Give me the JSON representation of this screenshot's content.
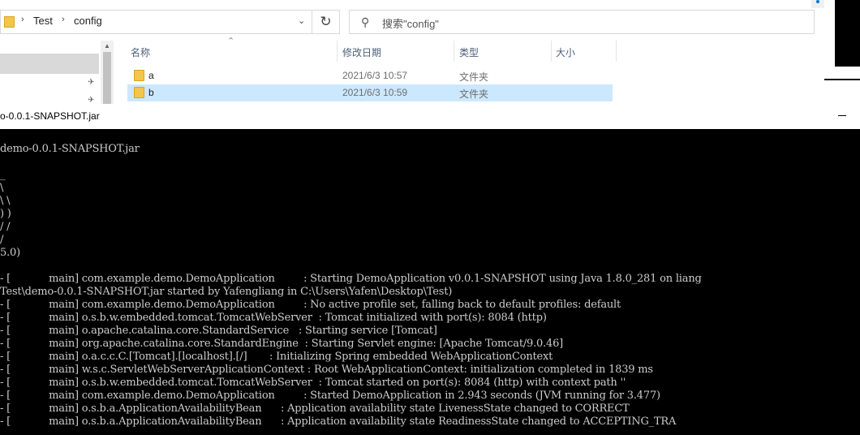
{
  "explorer": {
    "breadcrumb": [
      "Test",
      "config"
    ],
    "separator": "›",
    "dropdown_glyph": "⌄",
    "refresh_glyph": "↻",
    "search_placeholder": "搜索\"config\"",
    "search_icon": "search-icon",
    "columns": [
      "名称",
      "修改日期",
      "类型",
      "大小"
    ],
    "sort_glyph": "⌃",
    "files": [
      {
        "name": "a",
        "modified": "2021/6/3 10:57",
        "type": "文件夹",
        "selected": false
      },
      {
        "name": "b",
        "modified": "2021/6/3 10:59",
        "type": "文件夹",
        "selected": true
      }
    ],
    "pin_glyph": "📌"
  },
  "console": {
    "title": "o-0.0.1-SNAPSHOT.jar",
    "lines": [
      "demo-0.0.1-SNAPSHOT.jar",
      "",
      "_",
      "\\",
      "\\ \\",
      ") )",
      "/ /",
      "/",
      "5.0)",
      "",
      "- [            main] com.example.demo.DemoApplication         : Starting DemoApplication v0.0.1-SNAPSHOT using Java 1.8.0_281 on liang",
      "Test\\demo-0.0.1-SNAPSHOT.jar started by Yafengliang in C:\\Users\\Yafen\\Desktop\\Test)",
      "- [            main] com.example.demo.DemoApplication         : No active profile set, falling back to default profiles: default",
      "- [            main] o.s.b.w.embedded.tomcat.TomcatWebServer  : Tomcat initialized with port(s): 8084 (http)",
      "- [            main] o.apache.catalina.core.StandardService   : Starting service [Tomcat]",
      "- [            main] org.apache.catalina.core.StandardEngine  : Starting Servlet engine: [Apache Tomcat/9.0.46]",
      "- [            main] o.a.c.c.C.[Tomcat].[localhost].[/]       : Initializing Spring embedded WebApplicationContext",
      "- [            main] w.s.c.ServletWebServerApplicationContext : Root WebApplicationContext: initialization completed in 1839 ms",
      "- [            main] o.s.b.w.embedded.tomcat.TomcatWebServer  : Tomcat started on port(s): 8084 (http) with context path ''",
      "- [            main] com.example.demo.DemoApplication         : Started DemoApplication in 2.943 seconds (JVM running for 3.477)",
      "- [            main] o.s.b.a.ApplicationAvailabilityBean      : Application availability state LivenessState changed to CORRECT",
      "- [            main] o.s.b.a.ApplicationAvailabilityBean      : Application availability state ReadinessState changed to ACCEPTING_TRA"
    ]
  },
  "colors": {
    "console_bg": "#000000",
    "console_text": "#cccccc",
    "selection": "#cce8ff",
    "folder": "#f3c54b"
  }
}
